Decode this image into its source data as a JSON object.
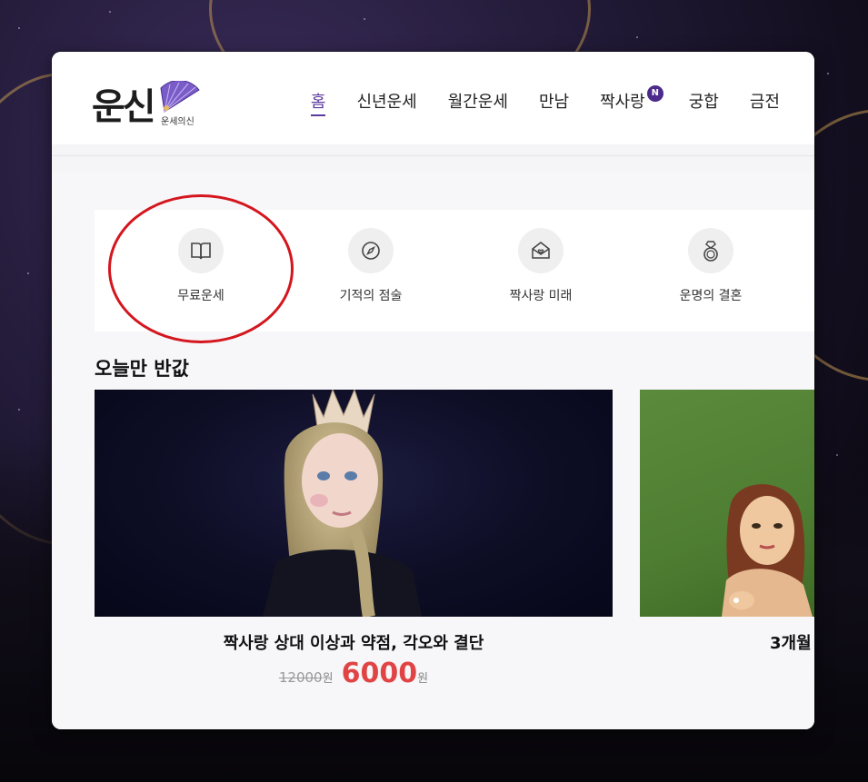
{
  "logo": {
    "main": "운신",
    "sub": "운세의신"
  },
  "nav": {
    "items": [
      {
        "label": "홈",
        "active": true
      },
      {
        "label": "신년운세"
      },
      {
        "label": "월간운세"
      },
      {
        "label": "만남"
      },
      {
        "label": "짝사랑",
        "badge": "N"
      },
      {
        "label": "궁합"
      },
      {
        "label": "금전"
      }
    ]
  },
  "quick_menu": [
    {
      "label": "무료운세",
      "icon": "book-icon"
    },
    {
      "label": "기적의 점술",
      "icon": "compass-icon"
    },
    {
      "label": "짝사랑 미래",
      "icon": "love-letter-icon"
    },
    {
      "label": "운명의 결혼",
      "icon": "ring-icon"
    }
  ],
  "section": {
    "title": "오늘만 반값"
  },
  "cards": [
    {
      "title": "짝사랑 상대 이상과 약점, 각오와 결단",
      "old_price": "12000",
      "old_unit": "원",
      "new_price": "6000",
      "new_unit": "원"
    },
    {
      "title": "3개월"
    }
  ],
  "colors": {
    "accent": "#5b3a9e",
    "price": "#e04444",
    "annotation": "#d4161e"
  }
}
